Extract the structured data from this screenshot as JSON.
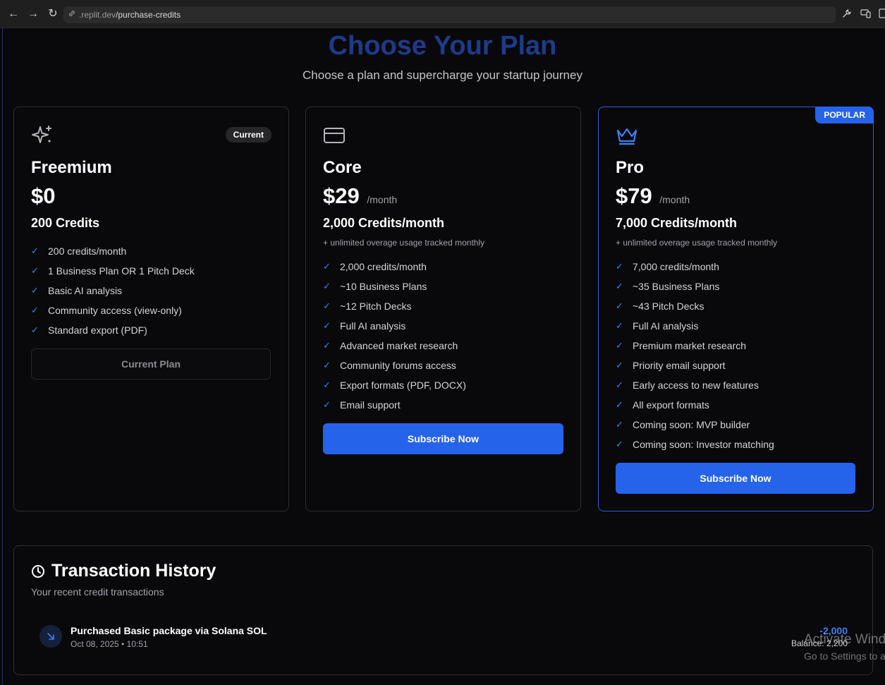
{
  "browser": {
    "url_prefix": ".replit.dev",
    "url_path": "/purchase-credits",
    "back_glyph": "←",
    "forward_glyph": "→",
    "reload_glyph": "↻"
  },
  "header": {
    "title": "Choose Your Plan",
    "subtitle": "Choose a plan and supercharge your startup journey"
  },
  "plans": [
    {
      "icon": "sparkles-icon",
      "badge": "Current",
      "name": "Freemium",
      "price": "$0",
      "period": "",
      "credits": "200 Credits",
      "overage": "",
      "features": [
        "200 credits/month",
        "1 Business Plan OR 1 Pitch Deck",
        "Basic AI analysis",
        "Community access (view-only)",
        "Standard export (PDF)"
      ],
      "button": "Current Plan"
    },
    {
      "icon": "credit-card-icon",
      "badge": "",
      "name": "Core",
      "price": "$29",
      "period": "/month",
      "credits": "2,000 Credits/month",
      "overage": "+ unlimited overage usage tracked monthly",
      "features": [
        "2,000 credits/month",
        "~10 Business Plans",
        "~12 Pitch Decks",
        "Full AI analysis",
        "Advanced market research",
        "Community forums access",
        "Export formats (PDF, DOCX)",
        "Email support"
      ],
      "button": "Subscribe Now"
    },
    {
      "icon": "crown-icon",
      "badge": "POPULAR",
      "name": "Pro",
      "price": "$79",
      "period": "/month",
      "credits": "7,000 Credits/month",
      "overage": "+ unlimited overage usage tracked monthly",
      "features": [
        "7,000 credits/month",
        "~35 Business Plans",
        "~43 Pitch Decks",
        "Full AI analysis",
        "Premium market research",
        "Priority email support",
        "Early access to new features",
        "All export formats",
        "Coming soon: MVP builder",
        "Coming soon: Investor matching"
      ],
      "button": "Subscribe Now"
    }
  ],
  "transactions": {
    "title": "Transaction History",
    "subtitle": "Your recent credit transactions",
    "items": [
      {
        "description": "Purchased Basic package via Solana SOL",
        "date": "Oct 08, 2025 • 10:51",
        "amount": "-2,000",
        "balance": "Balance: 2,200"
      }
    ]
  },
  "watermark": {
    "line1": "Activate Windows",
    "line2": "Go to Settings to activate Windows."
  },
  "colors": {
    "accent": "#2563eb",
    "title": "#1e3a8a",
    "background": "#09090b"
  }
}
